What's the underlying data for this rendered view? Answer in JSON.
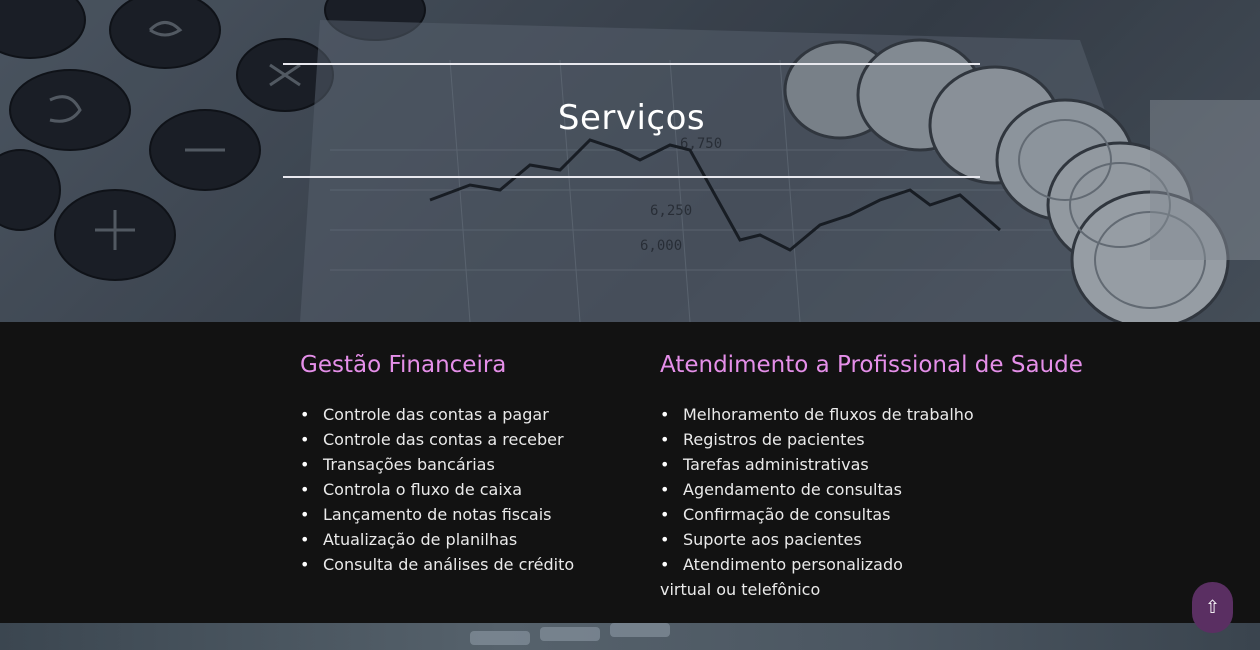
{
  "hero": {
    "title": "Serviços",
    "background_image": "calculator-coins-stock-chart"
  },
  "services": {
    "left": {
      "heading": "Gestão Financeira",
      "items": [
        "Controle das contas a pagar",
        "Controle das contas a receber",
        "Transações bancárias",
        "Controla o fluxo de caixa",
        "Lançamento de notas fiscais",
        "Atualização de planilhas",
        "Consulta de análises de crédito"
      ]
    },
    "right": {
      "heading": "Atendimento a Profissional de Saude",
      "items": [
        "Melhoramento de fluxos de trabalho",
        "Registros de pacientes",
        "Tarefas administrativas",
        "Agendamento de consultas",
        "Confirmação de consultas",
        "Suporte aos pacientes",
        "Atendimento personalizado",
        "virtual ou telefônico"
      ]
    }
  },
  "scroll_top": {
    "icon": "up-arrow-icon",
    "glyph": "⇧"
  },
  "colors": {
    "heading_accent": "#e58fe9",
    "section_bg": "#121212",
    "button_bg": "#5a2f62"
  }
}
